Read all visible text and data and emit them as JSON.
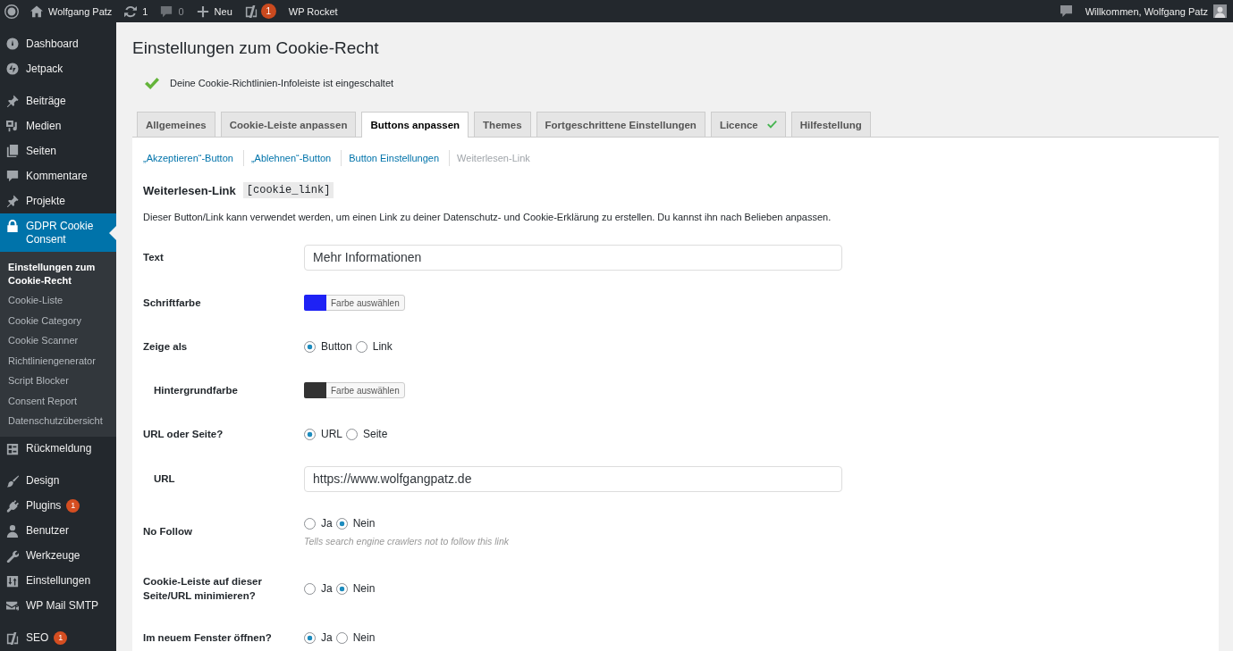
{
  "admin_bar": {
    "items": [
      {
        "label": "Wolfgang Patz",
        "dimmed": false
      },
      {
        "label": "1",
        "dimmed": false
      },
      {
        "label": "0",
        "dimmed": true
      },
      {
        "label": "Neu",
        "dimmed": false
      },
      {
        "badge": "1",
        "dimmed": false
      },
      {
        "label": "WP Rocket",
        "dimmed": false
      }
    ],
    "greeting": "Willkommen, Wolfgang Patz"
  },
  "sidebar": {
    "sections": [
      {
        "items": [
          {
            "label": "Dashboard",
            "selected": false
          },
          {
            "label": "Jetpack",
            "selected": false
          }
        ]
      },
      {
        "items": [
          {
            "label": "Beiträge",
            "selected": false
          },
          {
            "label": "Medien",
            "selected": false
          },
          {
            "label": "Seiten",
            "selected": false
          },
          {
            "label": "Kommentare",
            "selected": false
          },
          {
            "label": "Projekte",
            "selected": false
          },
          {
            "label": "GDPR Cookie Consent",
            "selected": true,
            "children": [
              {
                "label": "Einstellungen zum Cookie-Recht",
                "selected": true
              },
              {
                "label": "Cookie-Liste",
                "selected": false
              },
              {
                "label": "Cookie Category",
                "selected": false
              },
              {
                "label": "Cookie Scanner",
                "selected": false
              },
              {
                "label": "Richtliniengenerator",
                "selected": false
              },
              {
                "label": "Script Blocker",
                "selected": false
              },
              {
                "label": "Consent Report",
                "selected": false
              },
              {
                "label": "Datenschutzübersicht",
                "selected": false
              }
            ]
          },
          {
            "label": "Rückmeldung",
            "selected": false
          }
        ]
      },
      {
        "items": [
          {
            "label": "Design",
            "selected": false
          },
          {
            "label": "Plugins",
            "selected": false,
            "badge": "1"
          },
          {
            "label": "Benutzer",
            "selected": false
          },
          {
            "label": "Werkzeuge",
            "selected": false
          },
          {
            "label": "Einstellungen",
            "selected": false
          },
          {
            "label": "WP Mail SMTP",
            "selected": false
          }
        ]
      },
      {
        "items": [
          {
            "label": "SEO",
            "selected": false,
            "badge": "1"
          }
        ]
      }
    ]
  },
  "page": {
    "title": "Einstellungen zum Cookie-Recht",
    "notice": "Deine Cookie-Richtlinien-Infoleiste ist eingeschaltet",
    "tabs": [
      {
        "label": "Allgemeines",
        "selected": false,
        "verified": false
      },
      {
        "label": "Cookie-Leiste anpassen",
        "selected": false,
        "verified": false
      },
      {
        "label": "Buttons anpassen",
        "selected": true,
        "verified": false
      },
      {
        "label": "Themes",
        "selected": false,
        "verified": false
      },
      {
        "label": "Fortgeschrittene Einstellungen",
        "selected": false,
        "verified": false
      },
      {
        "label": "Licence",
        "selected": false,
        "verified": true
      },
      {
        "label": "Hilfestellung",
        "selected": false,
        "verified": false
      }
    ],
    "subtabs": [
      {
        "label": "„Akzeptieren“-Button",
        "selected": false
      },
      {
        "label": "„Ablehnen“-Button",
        "selected": false
      },
      {
        "label": "Button Einstellungen",
        "selected": false
      },
      {
        "label": "Weiterlesen-Link",
        "selected": true
      }
    ],
    "section": {
      "title": "Weiterlesen-Link",
      "shortcode": "[cookie_link]",
      "description": "Dieser Button/Link kann verwendet werden, um einen Link zu deiner Datenschutz- und Cookie-Erklärung zu erstellen. Du kannst ihn nach Belieben anpassen."
    },
    "fields": [
      {
        "kind": "text",
        "label": "Text",
        "value": "Mehr Informationen"
      },
      {
        "kind": "color",
        "label": "Schriftfarbe",
        "color": "#1e22f5",
        "button": "Farbe auswählen"
      },
      {
        "kind": "radio",
        "label": "Zeige als",
        "options": [
          {
            "label": "Button",
            "selected": true
          },
          {
            "label": "Link",
            "selected": false
          }
        ],
        "children": [
          {
            "kind": "color",
            "label": "Hintergrundfarbe",
            "color": "#333333",
            "button": "Farbe auswählen"
          }
        ]
      },
      {
        "kind": "radio",
        "label": "URL oder Seite?",
        "options": [
          {
            "label": "URL",
            "selected": true
          },
          {
            "label": "Seite",
            "selected": false
          }
        ],
        "children": [
          {
            "kind": "text",
            "label": "URL",
            "value": "https://www.wolfgangpatz.de"
          }
        ]
      },
      {
        "kind": "radio",
        "label": "No Follow",
        "options": [
          {
            "label": "Ja",
            "selected": false
          },
          {
            "label": "Nein",
            "selected": true
          }
        ],
        "hint": "Tells search engine crawlers not to follow this link"
      },
      {
        "kind": "radio",
        "label": "Cookie-Leiste auf dieser Seite/URL minimieren?",
        "options": [
          {
            "label": "Ja",
            "selected": false
          },
          {
            "label": "Nein",
            "selected": true
          }
        ]
      },
      {
        "kind": "radio",
        "label": "Im neuem Fenster öffnen?",
        "options": [
          {
            "label": "Ja",
            "selected": true
          },
          {
            "label": "Nein",
            "selected": false
          }
        ]
      }
    ]
  }
}
